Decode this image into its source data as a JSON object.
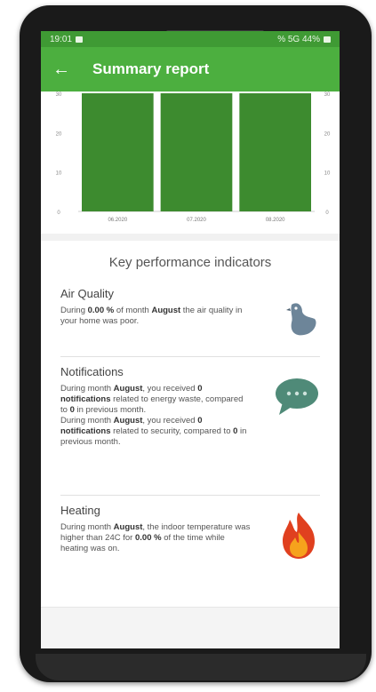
{
  "status": {
    "time": "19:01",
    "right": "% 5G 44%"
  },
  "appbar": {
    "title": "Summary report"
  },
  "chart_data": {
    "type": "bar",
    "categories": [
      "06.2020",
      "07.2020",
      "08.2020"
    ],
    "values": [
      30,
      30,
      30
    ],
    "y_ticks": [
      "0",
      "10",
      "20",
      "30"
    ],
    "ylim": [
      0,
      30
    ],
    "color": "#3d8b2f"
  },
  "kpi": {
    "heading": "Key performance indicators",
    "air": {
      "title": "Air Quality",
      "p1": "During ",
      "b1": "0.00 %",
      "p2": " of month ",
      "b2": "August",
      "p3": " the air quality in your home was poor."
    },
    "notifications": {
      "title": "Notifications",
      "p1": "During month ",
      "b1": "August",
      "p2": ", you received ",
      "b2": "0 notifications",
      "p3": " related to energy waste, compared to ",
      "b3": "0",
      "p4": " in previous month.",
      "p5": "During month ",
      "b5": "August",
      "p6": ", you received ",
      "b6": "0 notifications",
      "p7": " related to security, compared to ",
      "b7": "0",
      "p8": " in previous month."
    },
    "heating": {
      "title": "Heating",
      "p1": "During month ",
      "b1": "August",
      "p2": ", the indoor temperature was higher than 24C for ",
      "b2": "0.00 %",
      "p3": " of the time while heating was on."
    }
  },
  "colors": {
    "appbar": "#4caf3f",
    "bar": "#3d8b2f",
    "bird": "#6d8599",
    "chat": "#4f8a78",
    "fire": "#e0401f"
  }
}
